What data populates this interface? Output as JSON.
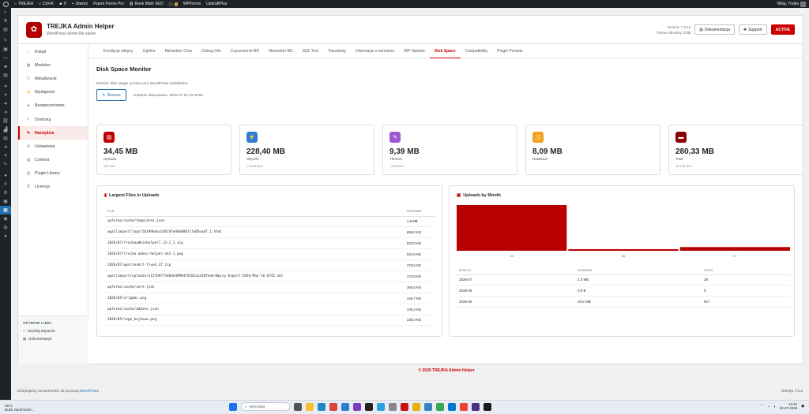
{
  "adminbar": {
    "site": "TREJKA",
    "shortcut": "Ctrl+K",
    "comments": "0",
    "new_label": "Utwórz",
    "fluent": "Fluent Forms Pro",
    "rankmath": "Rank Math SEO",
    "pending": "4",
    "wpforms": "WPForms",
    "updraft": "UpdraftPlus",
    "greeting": "Witaj, Trejka"
  },
  "menu_icons": [
    "dashboard-icon",
    "tool-icon",
    "comments-icon",
    "pin-icon",
    "media-icon",
    "pages-icon",
    "comment-bubble-icon",
    "form-icon",
    "arrow-icon",
    "plugin-icon",
    "arrow-icon",
    "arrow-icon",
    "link-icon",
    "chart-icon",
    "form-icon",
    "arrow-icon",
    "plugin-icon",
    "wrench-icon",
    "users-icon",
    "tools-icon",
    "settings-icon",
    "active-plugin-icon",
    "table-icon",
    "circle-icon",
    "seo-icon",
    "collapse-icon"
  ],
  "plugin": {
    "title": "TREJKA Admin Helper",
    "subtitle": "WordPress admin life easier",
    "version": "Version: 7.13.2",
    "theme": "Theme: Blocksy Child",
    "doc_btn": "Dokumentacja",
    "support_btn": "Support",
    "active_btn": "ACTIVE"
  },
  "sidebar": {
    "items": [
      {
        "label": "Kokpit",
        "icon": "home-icon"
      },
      {
        "label": "Modules",
        "icon": "grid-icon"
      },
      {
        "label": "Aktualizacje",
        "icon": "refresh-icon"
      },
      {
        "label": "Wydajność",
        "icon": "lightning-icon"
      },
      {
        "label": "Bezpieczeństwo",
        "icon": "shield-icon"
      },
      {
        "label": "Dostosuj",
        "icon": "brush-icon"
      },
      {
        "label": "Narzędzia",
        "icon": "wrench-icon"
      },
      {
        "label": "Ustawienia",
        "icon": "gear-icon"
      },
      {
        "label": "Content",
        "icon": "doc-icon"
      },
      {
        "label": "Plugin Library",
        "icon": "library-icon"
      },
      {
        "label": "Licencja",
        "icon": "key-icon"
      }
    ],
    "quick_title": "SZYBKIE LINKI",
    "quick_links": [
      "Usyskaj wsparcie",
      "Dokumentacja"
    ]
  },
  "tabs": [
    "Kondycja witryny",
    "Ogólne",
    "Menedżer Cron",
    "Debug Info",
    "Czyszczenie BD",
    "Menedżer BD",
    "SQL Tool",
    "Transienty",
    "Informacje o serwerze",
    "WP Options",
    "Disk Space",
    "Compatibility",
    "Plugin Presets"
  ],
  "section": {
    "title": "Disk Space Monitor",
    "desc": "Monitor disk usage across your WordPress installation.",
    "rescan": "Rescan",
    "last_scan": "Ostatnie skanowanie: 2026-07-20 10:39:59"
  },
  "cards": [
    {
      "value": "34,45 MB",
      "label": "Uploads",
      "sub": "985 files",
      "color": "#c00000",
      "icon": "image-icon"
    },
    {
      "value": "228,40 MB",
      "label": "Wtyczki",
      "sub": "13,645 files",
      "color": "#2f7bd9",
      "icon": "plug-icon"
    },
    {
      "value": "9,39 MB",
      "label": "Themes",
      "sub": "1,538 files",
      "color": "#9b59d0",
      "icon": "brush-icon"
    },
    {
      "value": "8,09 MB",
      "label": "Database",
      "sub": "",
      "color": "#f1a21a",
      "icon": "database-icon"
    },
    {
      "value": "280,33 MB",
      "label": "Total",
      "sub": "18,165 files",
      "color": "#8b0000",
      "icon": "folder-icon"
    }
  ],
  "files_panel": {
    "title": "Largest Files in Uploads",
    "col_file": "FILE",
    "col_size": "ROZMIAR",
    "rows": [
      {
        "file": "wpforms/cache/templates.json",
        "size": "1,8 MB"
      },
      {
        "file": "wpallimport/logs/56199bebcb367dfe48e0887c7a05ead7.1.html",
        "size": "696,0 KB"
      },
      {
        "file": "2026/07/trejkaadminhelper7.13-2_1.zip",
        "size": "623,0 KB"
      },
      {
        "file": "2026/07/trejka-admin-helper-3e2-1.png",
        "size": "534,5 KB"
      },
      {
        "file": "2026/07/wpsiteskit-fixed_37.zip",
        "size": "278,6 KB"
      },
      {
        "file": "wpallimport/uploads/a12fb9773d6ded8984fd181a1420fede/Wpisy-Export-2026-May-16-0742.xml",
        "size": "275,8 KB"
      },
      {
        "file": "wpforms/cache/core.json",
        "size": "265,5 KB"
      },
      {
        "file": "2026/05/origami.png",
        "size": "248,7 KB"
      },
      {
        "file": "wpforms/cache/addons.json",
        "size": "245,3 KB"
      },
      {
        "file": "2026/05/logo_bejkowa.png",
        "size": "238,4 KB"
      }
    ]
  },
  "month_panel": {
    "title": "Uploads by Month",
    "col_month": "MONTH",
    "col_size": "ROZMIAR",
    "col_files": "FILES",
    "rows": [
      {
        "month": "2026-07",
        "size": "2,3 MB",
        "files": "28"
      },
      {
        "month": "2026-06",
        "size": "0,0 B",
        "files": "0"
      },
      {
        "month": "2026-05",
        "size": "28,5 MB",
        "files": "917"
      }
    ]
  },
  "chart_data": {
    "type": "bar",
    "categories": [
      "05",
      "06",
      "07"
    ],
    "values": [
      28.5,
      1,
      2.3
    ],
    "colors": [
      "#b80000",
      "#b80000",
      "#b80000"
    ],
    "title": "",
    "ylim": [
      0,
      28.5
    ]
  },
  "footer": "© 2026 TREJKA Admin Helper",
  "wp_footer": {
    "prefix": "Dziękujemy za tworzenie za pomocą",
    "link": "WordPress",
    "version": "Wersja 7.0.2"
  },
  "taskbar": {
    "weather_temp": "19°C",
    "weather_desc": "Duże zachmurze...",
    "search": "Wyszukaj",
    "time": "12:41",
    "date": "20.07.2026"
  }
}
